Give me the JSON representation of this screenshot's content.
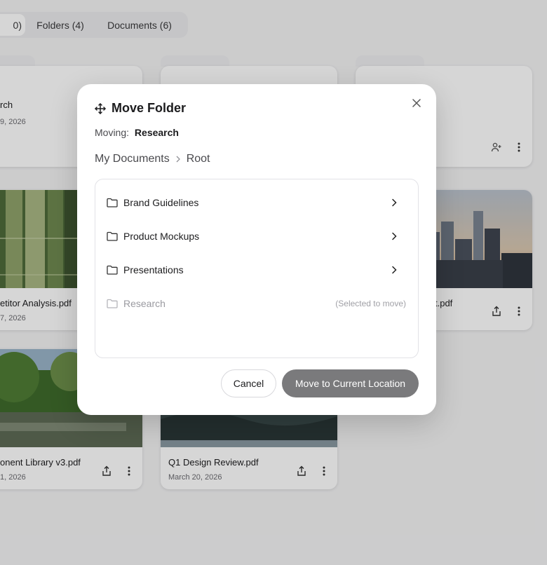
{
  "tabs": [
    {
      "label": "0)"
    },
    {
      "label": "Folders (4)"
    },
    {
      "label": "Documents (6)"
    }
  ],
  "cards": {
    "research_folder": {
      "title": "rch",
      "date": "9, 2026"
    },
    "competitor": {
      "title": "etitor Analysis.pdf",
      "date": "7, 2026"
    },
    "city_pdf": {
      "title": "t.pdf"
    },
    "component_lib": {
      "title": "onent Library v3.pdf",
      "date": "1, 2026"
    },
    "q1_review": {
      "title": "Q1 Design Review.pdf",
      "date": "March 20, 2026"
    }
  },
  "modal": {
    "title": "Move Folder",
    "moving_label": "Moving:",
    "moving_value": "Research",
    "breadcrumb": [
      "My Documents",
      "Root"
    ],
    "folders": [
      {
        "name": "Brand Guidelines",
        "disabled": false
      },
      {
        "name": "Product Mockups",
        "disabled": false
      },
      {
        "name": "Presentations",
        "disabled": false
      },
      {
        "name": "Research",
        "disabled": true,
        "note": "(Selected to move)"
      }
    ],
    "cancel_label": "Cancel",
    "move_label": "Move to Current Location"
  },
  "icons": {
    "title": "move-arrows-icon",
    "close": "close-icon",
    "folder": "folder-icon",
    "chevron": "chevron-right-icon",
    "share": "share-icon",
    "more": "more-vertical-icon",
    "add_user": "add-user-icon"
  },
  "colors": {
    "primary_disabled": "#7a7a7c",
    "overlay": "rgba(0,0,0,0.16)",
    "muted_text": "#9a9aa0"
  }
}
